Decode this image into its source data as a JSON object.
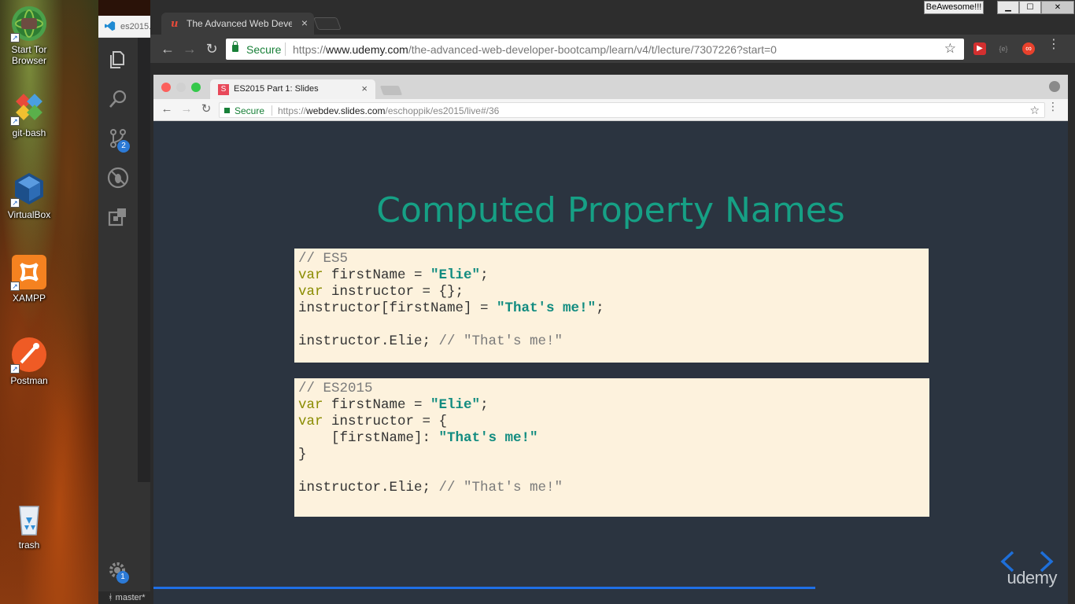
{
  "desktop": {
    "icons": [
      {
        "label": "Start Tor\nBrowser"
      },
      {
        "label": "git-bash"
      },
      {
        "label": "VirtualBox"
      },
      {
        "label": "XAMPP"
      },
      {
        "label": "Postman"
      },
      {
        "label": "trash"
      }
    ]
  },
  "vscode": {
    "tab_label": "es2015.",
    "scm_badge": "2",
    "settings_badge": "1",
    "branch": "master*"
  },
  "outer_browser": {
    "tab_title": "The Advanced Web Deve",
    "tag_button": "BeAwesome!!!",
    "omnibox": {
      "secure_label": "Secure",
      "url_scheme": "https://",
      "url_host": "www.udemy.com",
      "url_path": "/the-advanced-web-developer-bootcamp/learn/v4/t/lecture/7307226?start=0"
    },
    "extensions": [
      "red-play",
      "json-viewer",
      "infinity"
    ]
  },
  "inner_browser": {
    "tab_title": "ES2015 Part 1: Slides",
    "tab_favicon": "S",
    "omnibox": {
      "secure_label": "Secure",
      "url_scheme": "https://",
      "url_host": "webdev.slides.com",
      "url_path": "/eschoppik/es2015/live#/36"
    }
  },
  "slide": {
    "title": "Computed Property Names",
    "code_blocks": [
      {
        "lines": [
          [
            {
              "t": "// ES5",
              "c": "cm"
            }
          ],
          [
            {
              "t": "var",
              "c": "kw"
            },
            {
              "t": " firstName = ",
              "c": ""
            },
            {
              "t": "\"Elie\"",
              "c": "st"
            },
            {
              "t": ";",
              "c": ""
            }
          ],
          [
            {
              "t": "var",
              "c": "kw"
            },
            {
              "t": " instructor = {};",
              "c": ""
            }
          ],
          [
            {
              "t": "instructor[firstName] = ",
              "c": ""
            },
            {
              "t": "\"That's me!\"",
              "c": "st"
            },
            {
              "t": ";",
              "c": ""
            }
          ],
          [],
          [
            {
              "t": "instructor.Elie; ",
              "c": ""
            },
            {
              "t": "// \"That's me!\"",
              "c": "cm"
            }
          ]
        ]
      },
      {
        "lines": [
          [
            {
              "t": "// ES2015",
              "c": "cm"
            }
          ],
          [
            {
              "t": "var",
              "c": "kw"
            },
            {
              "t": " firstName = ",
              "c": ""
            },
            {
              "t": "\"Elie\"",
              "c": "st"
            },
            {
              "t": ";",
              "c": ""
            }
          ],
          [
            {
              "t": "var",
              "c": "kw"
            },
            {
              "t": " instructor = {",
              "c": ""
            }
          ],
          [
            {
              "t": "    [firstName]: ",
              "c": ""
            },
            {
              "t": "\"That's me!\"",
              "c": "st"
            }
          ],
          [
            {
              "t": "}",
              "c": ""
            }
          ],
          [],
          [
            {
              "t": "instructor.Elie; ",
              "c": ""
            },
            {
              "t": "// \"That's me!\"",
              "c": "cm"
            }
          ]
        ]
      }
    ],
    "progress": 0.724,
    "logo": "udemy"
  },
  "colors": {
    "slide_bg": "#2b3440",
    "title": "#16a085",
    "code_bg": "#fdf2dd",
    "keyword": "#8a8c00",
    "string": "#128c80",
    "comment": "#7a7a7a",
    "progress": "#1f6fe6",
    "slide_nav": "#1e6fd9"
  }
}
